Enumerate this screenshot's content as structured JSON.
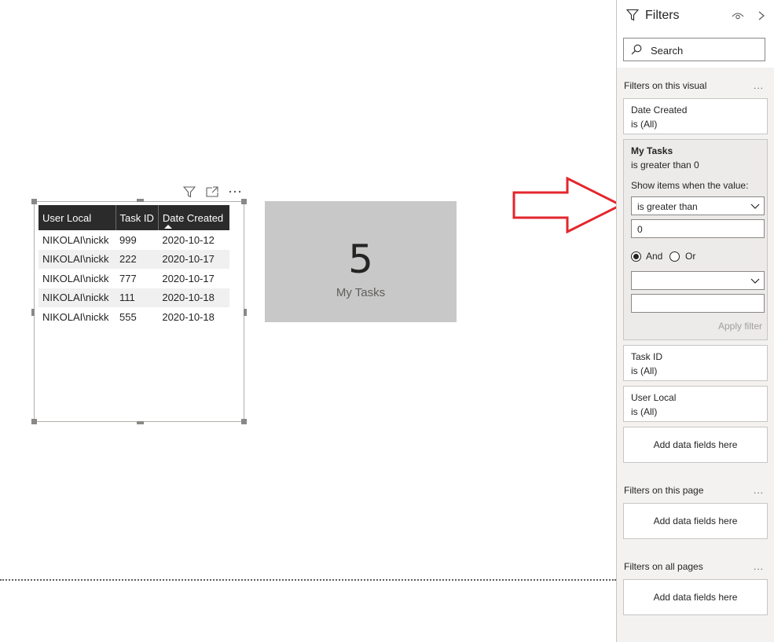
{
  "table": {
    "columns": [
      "User Local",
      "Task ID",
      "Date Created"
    ],
    "rows": [
      [
        "NIKOLAI\\nickk",
        "999",
        "2020-10-12"
      ],
      [
        "NIKOLAI\\nickk",
        "222",
        "2020-10-17"
      ],
      [
        "NIKOLAI\\nickk",
        "777",
        "2020-10-17"
      ],
      [
        "NIKOLAI\\nickk",
        "111",
        "2020-10-18"
      ],
      [
        "NIKOLAI\\nickk",
        "555",
        "2020-10-18"
      ]
    ],
    "sorted_column": "Date Created"
  },
  "visual_header_icons": [
    "filter-icon",
    "focus-mode-icon",
    "more-options-icon"
  ],
  "card": {
    "value": "5",
    "label": "My Tasks"
  },
  "filter_pane": {
    "title": "Filters",
    "search_placeholder": "Search",
    "sections": {
      "visual": {
        "title": "Filters on this visual",
        "more": "..."
      },
      "page": {
        "title": "Filters on this page",
        "more": "..."
      },
      "all_pages": {
        "title": "Filters on all pages",
        "more": "..."
      }
    },
    "cards": {
      "date_created": {
        "name": "Date Created",
        "state": "is (All)"
      },
      "my_tasks": {
        "name": "My Tasks",
        "state": "is greater than 0",
        "show_label": "Show items when the value:",
        "operator": "is greater than",
        "value": "0",
        "and_label": "And",
        "or_label": "Or",
        "logic_selected": "And",
        "operator2": "",
        "value2": "",
        "apply_label": "Apply filter"
      },
      "task_id": {
        "name": "Task ID",
        "state": "is (All)"
      },
      "user_local": {
        "name": "User Local",
        "state": "is (All)"
      }
    },
    "add_fields_label": "Add data fields here"
  },
  "colors": {
    "table_header": "#2b2b2b",
    "card_background": "#c8c8c8",
    "arrow": "#e3262c",
    "pane_background": "#f3f2f1"
  }
}
